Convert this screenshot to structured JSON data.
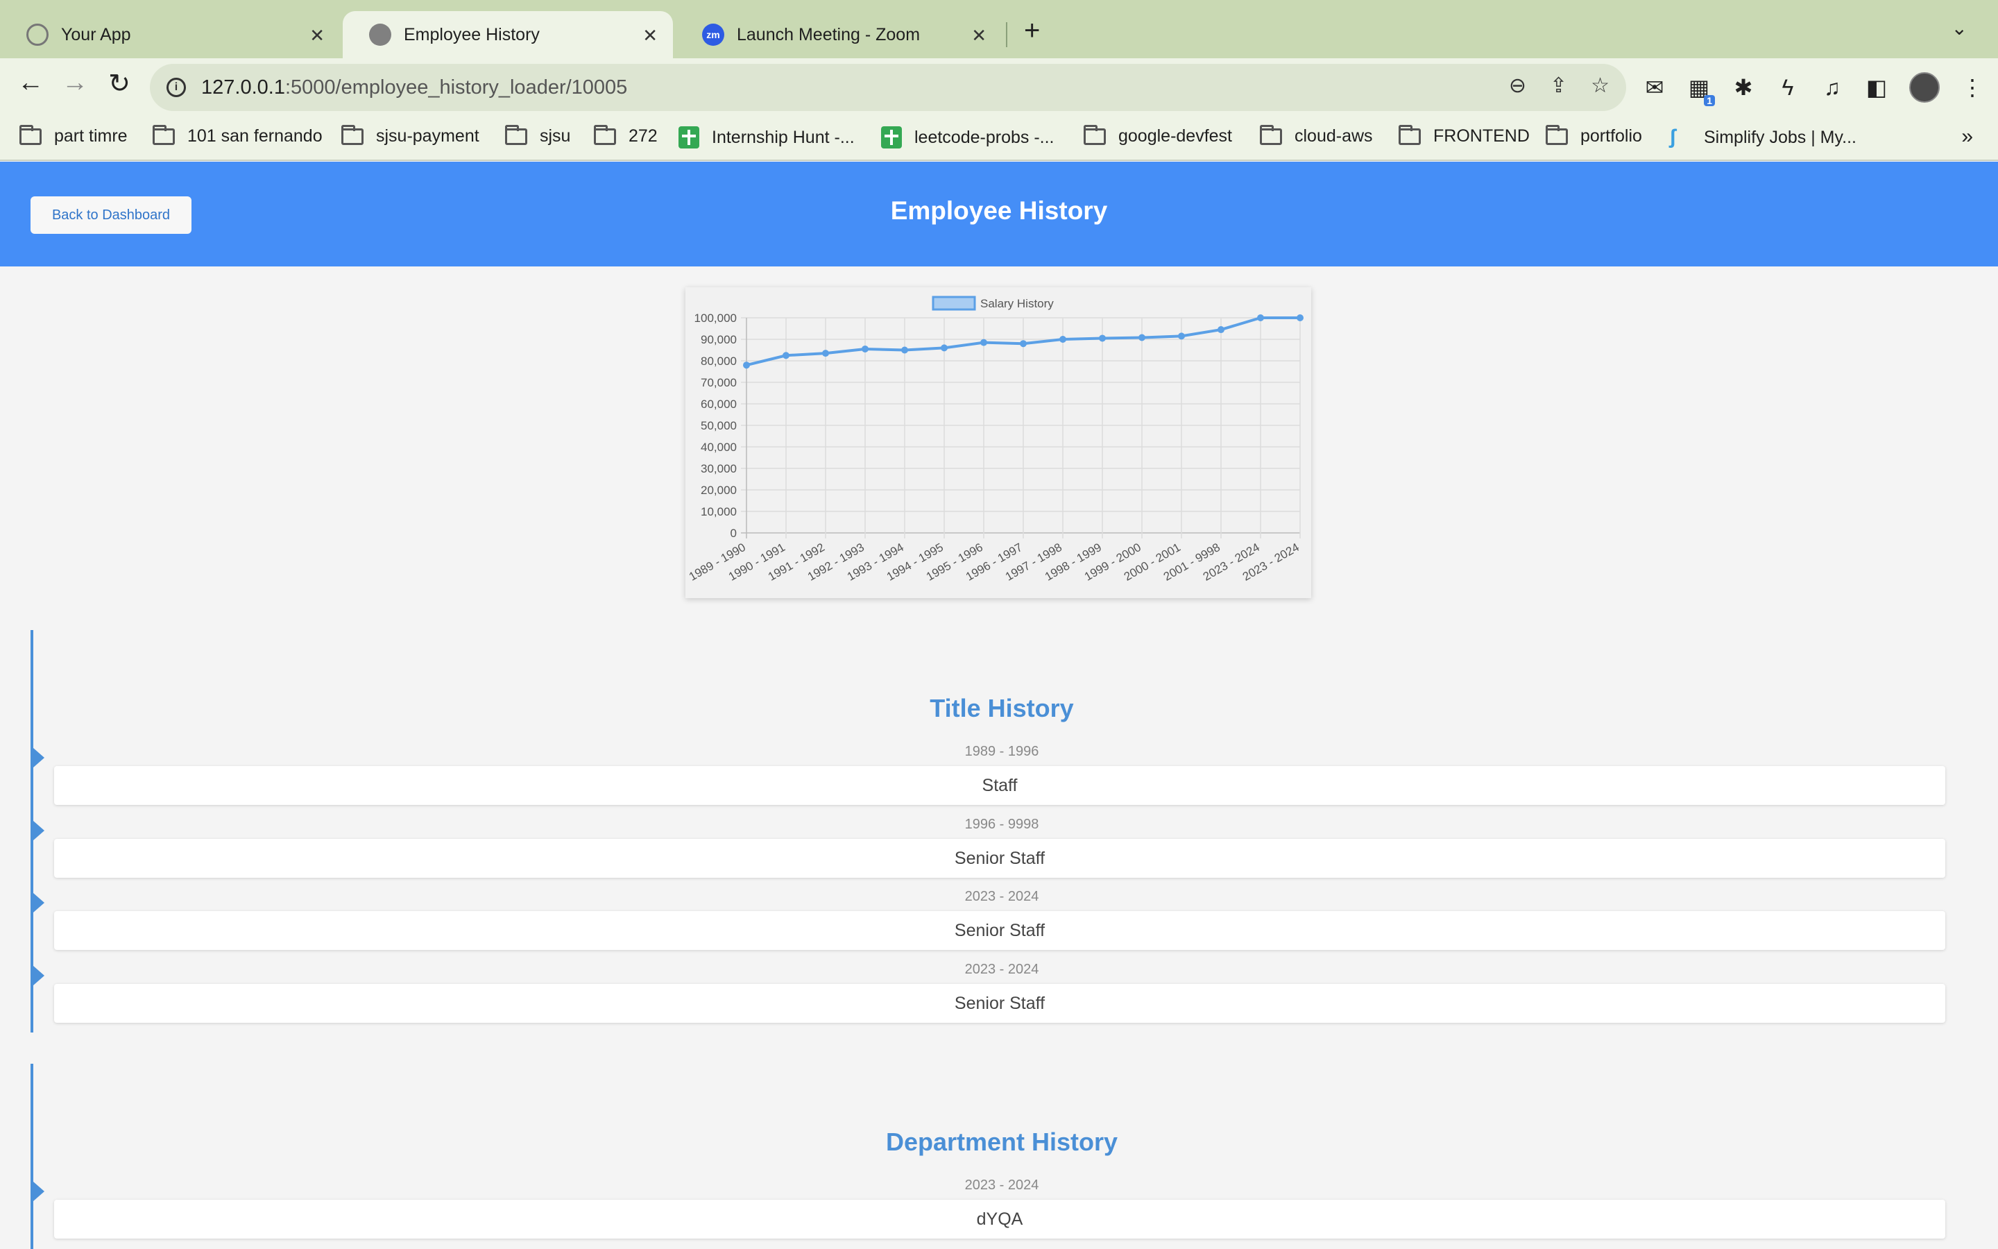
{
  "browser": {
    "tabs": [
      {
        "title": "Your App",
        "icon": "gear-favicon",
        "active": false
      },
      {
        "title": "Employee History",
        "icon": "globe-favicon",
        "active": true
      },
      {
        "title": "Launch Meeting - Zoom",
        "icon": "zoom-favicon",
        "active": false
      }
    ],
    "zoom_favicon_text": "zm",
    "url_host": "127.0.0.1",
    "url_path": ":5000/employee_history_loader/10005",
    "extension_badge": "1",
    "bookmarks": [
      {
        "label": "part timre",
        "icon": "folder"
      },
      {
        "label": "101 san fernando",
        "icon": "folder"
      },
      {
        "label": "sjsu-payment",
        "icon": "folder"
      },
      {
        "label": "sjsu",
        "icon": "folder"
      },
      {
        "label": "272",
        "icon": "folder"
      },
      {
        "label": "Internship Hunt -...",
        "icon": "sheets"
      },
      {
        "label": "leetcode-probs -...",
        "icon": "sheets"
      },
      {
        "label": "google-devfest",
        "icon": "folder"
      },
      {
        "label": "cloud-aws",
        "icon": "folder"
      },
      {
        "label": "FRONTEND",
        "icon": "folder"
      },
      {
        "label": "portfolio",
        "icon": "folder"
      },
      {
        "label": "Simplify Jobs | My...",
        "icon": "simplify"
      }
    ],
    "bookmarks_more": "»"
  },
  "header": {
    "back_label": "Back to Dashboard",
    "title": "Employee History",
    "color": "#458ef7"
  },
  "chart_data": {
    "type": "line",
    "legend": "Salary History",
    "legend_position": "top",
    "color": "#5ba0e6",
    "grid": true,
    "categories": [
      "1989 - 1990",
      "1990 - 1991",
      "1991 - 1992",
      "1992 - 1993",
      "1993 - 1994",
      "1994 - 1995",
      "1995 - 1996",
      "1996 - 1997",
      "1997 - 1998",
      "1998 - 1999",
      "1999 - 2000",
      "2000 - 2001",
      "2001 - 9998",
      "2023 - 2024",
      "2023 - 2024"
    ],
    "values": [
      78000,
      82500,
      83500,
      85500,
      85000,
      86000,
      88500,
      88000,
      90000,
      90500,
      90800,
      91500,
      94500,
      100000,
      100000
    ],
    "ylim": [
      0,
      100000
    ],
    "yticks": [
      "0",
      "10,000",
      "20,000",
      "30,000",
      "40,000",
      "50,000",
      "60,000",
      "70,000",
      "80,000",
      "90,000",
      "100,000"
    ]
  },
  "title_history": {
    "heading": "Title History",
    "entries": [
      {
        "dates": "1989 - 1996",
        "title": "Staff"
      },
      {
        "dates": "1996 - 9998",
        "title": "Senior Staff"
      },
      {
        "dates": "2023 - 2024",
        "title": "Senior Staff"
      },
      {
        "dates": "2023 - 2024",
        "title": "Senior Staff"
      }
    ]
  },
  "department_history": {
    "heading": "Department History",
    "entries": [
      {
        "dates": "2023 - 2024",
        "name": "dYQA"
      }
    ]
  }
}
